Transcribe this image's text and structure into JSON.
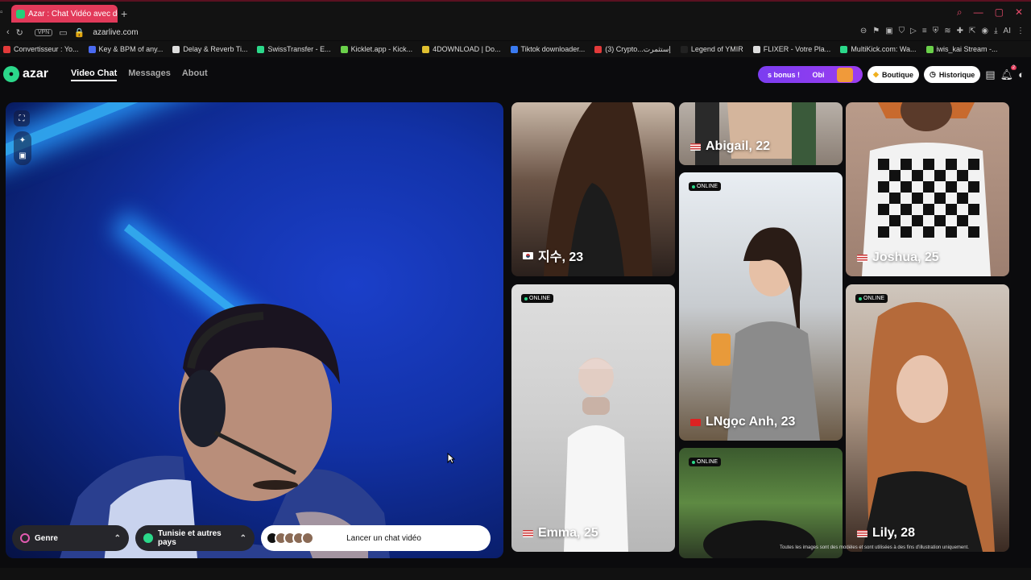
{
  "browser": {
    "tab_title": "Azar : Chat Vidéo avec de",
    "url": "azarlive.com",
    "vpn_label": "VPN",
    "ai_label": "AI",
    "bookmarks": [
      {
        "label": "Convertisseur : Yo...",
        "color": "#e23a3a"
      },
      {
        "label": "Key & BPM of any...",
        "color": "#4a6af0"
      },
      {
        "label": "Delay & Reverb Ti...",
        "color": "#dddddd"
      },
      {
        "label": "SwissTransfer - E...",
        "color": "#2bd88a"
      },
      {
        "label": "Kicklet.app - Kick...",
        "color": "#6ad04a"
      },
      {
        "label": "4DOWNLOAD | Do...",
        "color": "#e0c030"
      },
      {
        "label": "Tiktok downloader...",
        "color": "#3a7af0"
      },
      {
        "label": "(3) Crypto...إستثمرت",
        "color": "#e23a3a"
      },
      {
        "label": "Legend of YMIR",
        "color": "#222222"
      },
      {
        "label": "FLIXER - Votre Pla...",
        "color": "#dddddd"
      },
      {
        "label": "MultiKick.com: Wa...",
        "color": "#2bd88a"
      },
      {
        "label": "iwis_kai Stream -...",
        "color": "#6ad04a"
      }
    ]
  },
  "header": {
    "logo_text": "azar",
    "nav": [
      {
        "label": "Video Chat",
        "active": true
      },
      {
        "label": "Messages",
        "active": false
      },
      {
        "label": "About",
        "active": false
      }
    ],
    "bonus_label": "s bonus !",
    "bonus_user": "Obi",
    "boutique_label": "Boutique",
    "historique_label": "Historique",
    "notif_count": "2"
  },
  "controls": {
    "genre_label": "Genre",
    "country_label": "Tunisie et autres pays",
    "launch_label": "Lancer un chat vidéo"
  },
  "gallery": {
    "online_label": "ONLINE",
    "disclaimer": "Toutes les images sont des modèles et sont utilisées à des fins d'illustration uniquement.",
    "cards": [
      {
        "name": "지수, 23",
        "flag": "kr",
        "online": false
      },
      {
        "name": "Abigail, 22",
        "flag": "us",
        "online": false
      },
      {
        "name": "Joshua, 25",
        "flag": "us",
        "online": false
      },
      {
        "name": "Emma, 25",
        "flag": "us",
        "online": true
      },
      {
        "name": "LNgọc Anh, 23",
        "flag": "vn",
        "online": true
      },
      {
        "name": "",
        "flag": "",
        "online": true
      },
      {
        "name": "Lily, 28",
        "flag": "us",
        "online": true
      }
    ]
  }
}
